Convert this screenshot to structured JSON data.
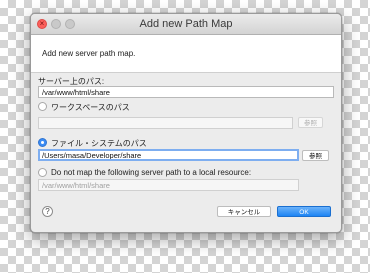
{
  "window": {
    "title": "Add new Path Map"
  },
  "banner": {
    "message": "Add new server path map."
  },
  "server_path": {
    "label": "サーバー上のパス:",
    "value": "/var/www/html/share"
  },
  "options": {
    "workspace": {
      "label": "ワークスペースのパス",
      "selected": false,
      "value": "",
      "browse_label": "参照"
    },
    "filesystem": {
      "label": "ファイル・システムのパス",
      "selected": true,
      "value": "/Users/masa/Developer/share",
      "browse_label": "参照"
    },
    "no_map": {
      "label": "Do not map the following server path to a local resource:",
      "selected": false,
      "value": "/var/www/html/share"
    }
  },
  "footer": {
    "help_symbol": "?",
    "cancel_label": "キャンセル",
    "ok_label": "OK"
  },
  "colors": {
    "accent": "#3b8cf5",
    "close_light": "#fc605c"
  },
  "icons": {
    "help": "help-icon",
    "close": "close-icon"
  }
}
